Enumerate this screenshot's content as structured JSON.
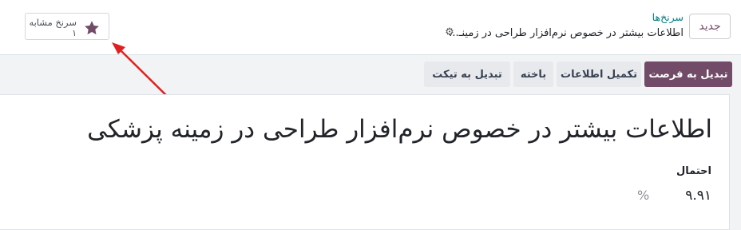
{
  "control_panel": {
    "new_label": "جدید",
    "breadcrumb_parent": "سرنخ‌ها",
    "breadcrumb_current": "اطلاعات بیشتر در خصوص نرم‌افزار طراحی در زمینـ...",
    "gear_icon": "gear-icon"
  },
  "smart_button": {
    "label": "سرنخ مشابه",
    "value": "۱",
    "icon": "star-icon",
    "icon_color": "#714b67"
  },
  "annotation": {
    "arrow_color": "#e0201f"
  },
  "statusbar": {
    "buttons": [
      {
        "label": "تبدیل به فرصت"
      },
      {
        "label": "تکمیل اطلاعات"
      },
      {
        "label": "باخته"
      },
      {
        "label": "تبدیل به تیکت"
      }
    ]
  },
  "form": {
    "title": "اطلاعات بیشتر در خصوص نرم‌افزار طراحی در زمینه پزشکی",
    "probability_label": "احتمال",
    "probability_value": "۹.۹۱",
    "probability_unit": "%"
  },
  "colors": {
    "brand": "#714b67",
    "link": "#017e84"
  }
}
